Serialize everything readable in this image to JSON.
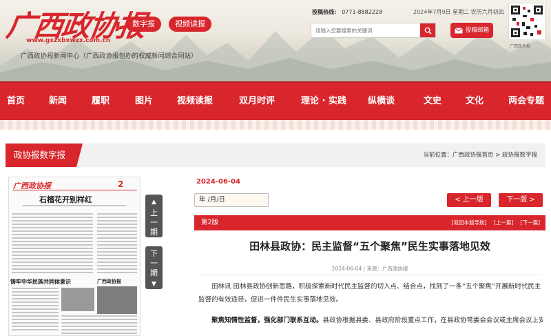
{
  "header": {
    "logo_text": "广西政协报",
    "logo_url": "www.gxzxbxwzx.com.cn",
    "tagline": "广西政协报新闻中心（广西政协报创办的权威新闻综合网站）",
    "buttons": {
      "digital": "数字报",
      "video": "视频读报"
    },
    "hotline_label": "投稿热线:",
    "hotline_number": "0771-8882228",
    "date": "2024年7月9日 星期二 农历六月初四",
    "search_placeholder": "请输入您要搜索的关键词",
    "mail_button": "投稿邮箱",
    "qr_caption": "广西政协报"
  },
  "nav": {
    "items": [
      "首页",
      "新闻",
      "履职",
      "图片",
      "视频读报",
      "双月时评",
      "理论 · 实践",
      "纵横谈",
      "文史",
      "文化",
      "两会专题"
    ]
  },
  "breadcrumb": {
    "section": "政协报数字报",
    "path": "当前位置：广西政协报首页 > 政协报数字报"
  },
  "paper": {
    "logo": "广西政协报",
    "page_no": "2",
    "headline1": "石榴花开别样红",
    "headline2": "铸牢中华民族共同体意识",
    "headline3": "广西政协报",
    "prev_page": "上一期",
    "next_page": "下一期"
  },
  "article": {
    "date_red": "2024-06-04",
    "date_input": "年 /月/日",
    "prev_edition": "< 上一版",
    "next_edition": "下一版 >",
    "version": "第2版",
    "version_links": [
      "[返回本版导航]",
      "[上一篇]",
      "[下一篇]"
    ],
    "title": "田林县政协：民主监督“五个聚焦”民生实事落地见效",
    "meta": "2024-06-04 | 来源：广西政协报",
    "para1": "田林讯  田林县政协创新思路，积极探索新时代民主监督的切入点、结合点，找到了一条“五个聚焦”开展新时代民主监督的有效途径，促进一件件民生实事落地见效。",
    "para2_bold": "聚焦知情性监督，强化部门联系互动。",
    "para2": "县政协根据县委、县政府阶段重点工作，在县政协常委会会议或主席会议上安排1—2"
  },
  "colors": {
    "brand_red": "#d8262c",
    "nav_red": "#d8262c",
    "dark_button": "#555555"
  }
}
